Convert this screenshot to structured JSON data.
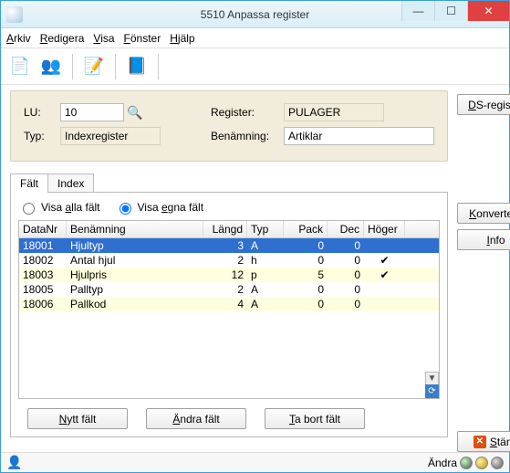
{
  "window": {
    "title": "5510 Anpassa register"
  },
  "menu": {
    "arkiv": "Arkiv",
    "redigera": "Redigera",
    "visa": "Visa",
    "fonster": "Fönster",
    "hjalp": "Hjälp"
  },
  "toolbar": {
    "doc": "📄",
    "users": "👥",
    "edit": "📝",
    "help": "📘"
  },
  "form": {
    "lu_label": "LU:",
    "lu_value": "10",
    "typ_label": "Typ:",
    "typ_value": "Indexregister",
    "register_label": "Register:",
    "register_value": "PULAGER",
    "benamning_label": "Benämning:",
    "benamning_value": "Artiklar"
  },
  "aside": {
    "ds_register": "DS-register",
    "konvertera": "Konvertera",
    "info": "Info",
    "stang": "Stäng"
  },
  "tabs": {
    "falt": "Fält",
    "index": "Index"
  },
  "radios": {
    "alla": "Visa alla fält",
    "egna": "Visa egna fält",
    "selected": "egna"
  },
  "grid": {
    "headers": {
      "datanr": "DataNr",
      "benamning": "Benämning",
      "langd": "Längd",
      "typ": "Typ",
      "pack": "Pack",
      "dec": "Dec",
      "hoger": "Höger"
    },
    "rows": [
      {
        "datanr": "18001",
        "benamning": "Hjultyp",
        "langd": "3",
        "typ": "A",
        "pack": "0",
        "dec": "0",
        "hoger": "",
        "sel": true,
        "alt": false
      },
      {
        "datanr": "18002",
        "benamning": "Antal hjul",
        "langd": "2",
        "typ": "h",
        "pack": "0",
        "dec": "0",
        "hoger": "✔",
        "sel": false,
        "alt": false
      },
      {
        "datanr": "18003",
        "benamning": "Hjulpris",
        "langd": "12",
        "typ": "p",
        "pack": "5",
        "dec": "0",
        "hoger": "✔",
        "sel": false,
        "alt": true
      },
      {
        "datanr": "18005",
        "benamning": "Palltyp",
        "langd": "2",
        "typ": "A",
        "pack": "0",
        "dec": "0",
        "hoger": "",
        "sel": false,
        "alt": false
      },
      {
        "datanr": "18006",
        "benamning": "Pallkod",
        "langd": "4",
        "typ": "A",
        "pack": "0",
        "dec": "0",
        "hoger": "",
        "sel": false,
        "alt": true
      }
    ]
  },
  "gridbtns": {
    "nytt": "Nytt fält",
    "andra": "Ändra fält",
    "tabort": "Ta bort fält"
  },
  "status": {
    "andra": "Ändra"
  }
}
